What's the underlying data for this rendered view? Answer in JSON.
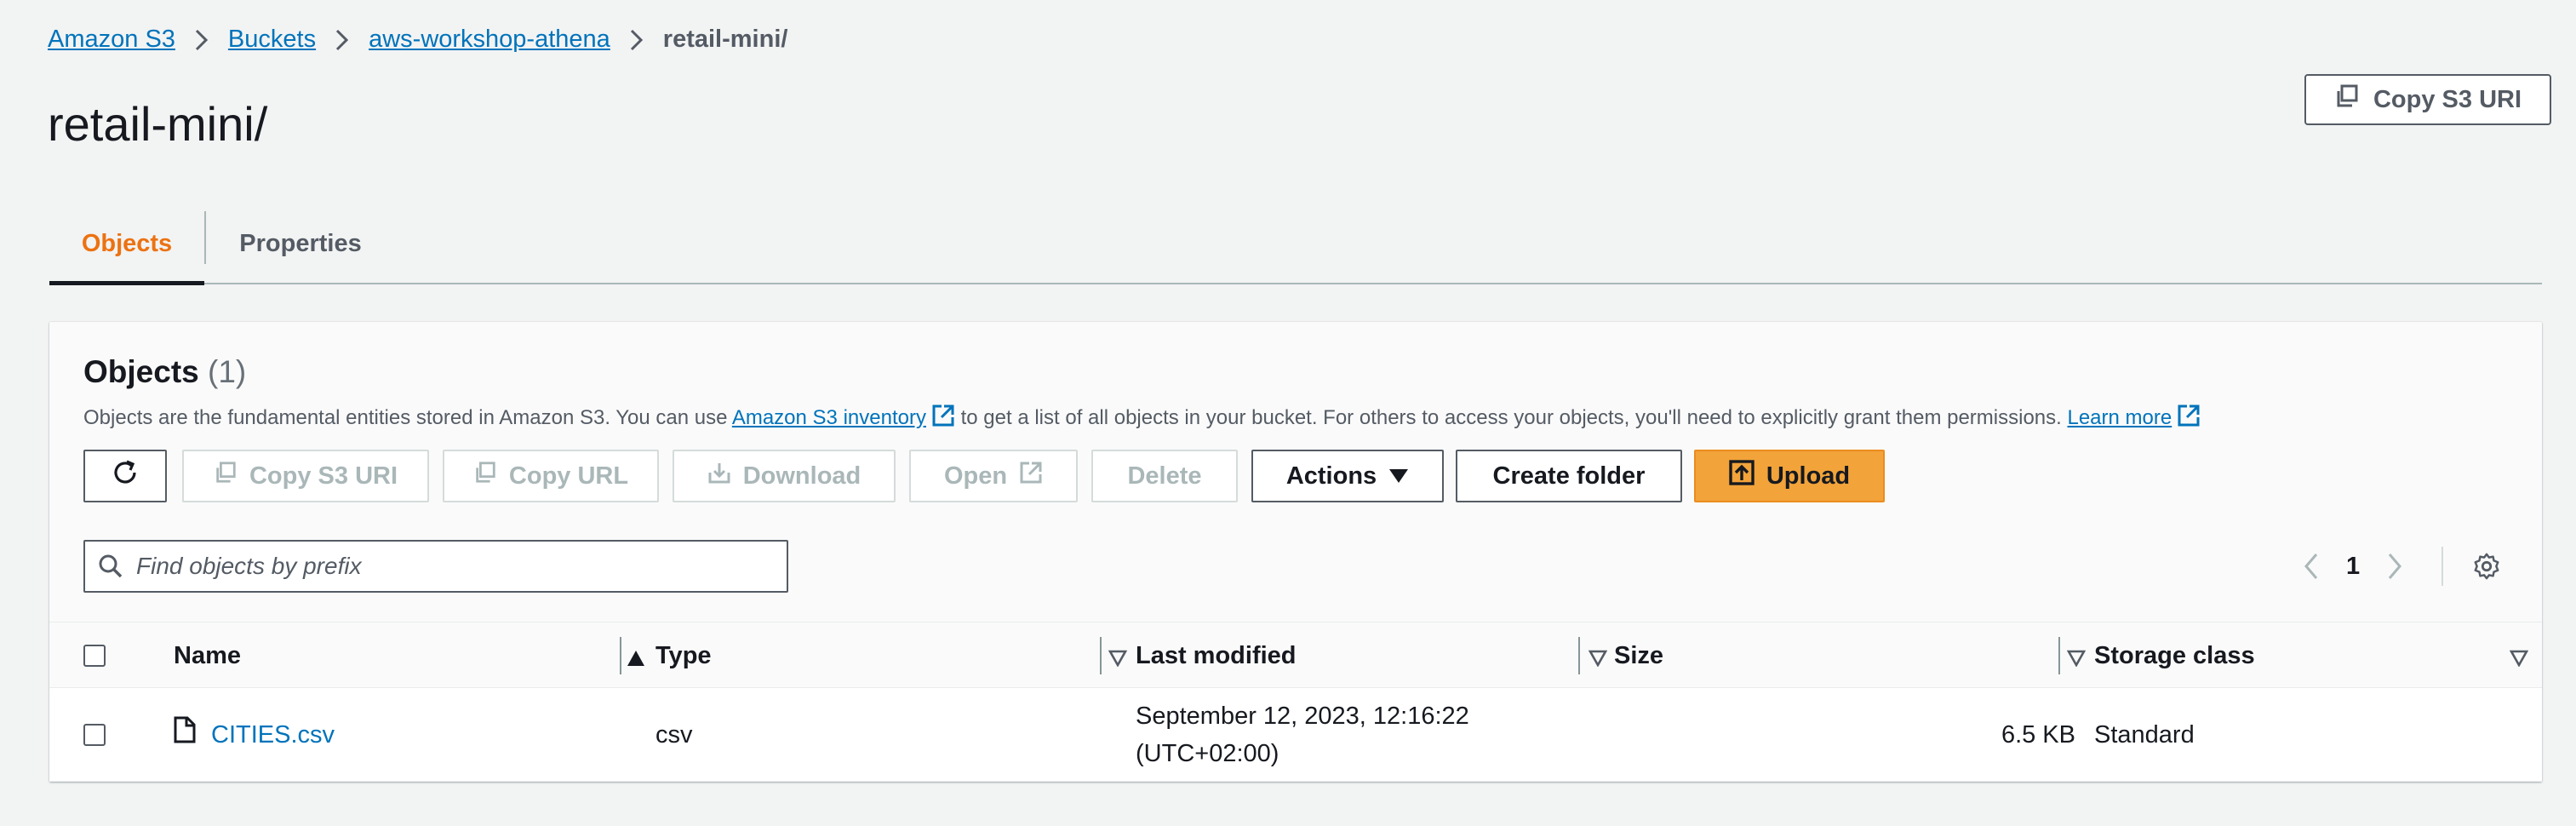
{
  "breadcrumb": {
    "items": [
      "Amazon S3",
      "Buckets",
      "aws-workshop-athena"
    ],
    "current": "retail-mini/"
  },
  "page": {
    "title": "retail-mini/",
    "copy_uri_label": "Copy S3 URI"
  },
  "tabs": [
    {
      "label": "Objects",
      "active": true
    },
    {
      "label": "Properties",
      "active": false
    }
  ],
  "objects_panel": {
    "title": "Objects",
    "count": "(1)",
    "description_1": "Objects are the fundamental entities stored in Amazon S3. You can use ",
    "inventory_link": "Amazon S3 inventory",
    "description_2": " to get a list of all objects in your bucket. For others to access your objects, you'll need to explicitly grant them permissions. ",
    "learn_more": "Learn more"
  },
  "toolbar": {
    "copy_s3_uri": "Copy S3 URI",
    "copy_url": "Copy URL",
    "download": "Download",
    "open": "Open",
    "delete": "Delete",
    "actions": "Actions",
    "create_folder": "Create folder",
    "upload": "Upload"
  },
  "search": {
    "placeholder": "Find objects by prefix",
    "value": ""
  },
  "pagination": {
    "current_page": "1"
  },
  "table": {
    "columns": [
      "Name",
      "Type",
      "Last modified",
      "Size",
      "Storage class"
    ],
    "rows": [
      {
        "name": "CITIES.csv",
        "type": "csv",
        "last_modified_line1": "September 12, 2023, 12:16:22",
        "last_modified_line2": "(UTC+02:00)",
        "size": "6.5 KB",
        "storage_class": "Standard"
      }
    ]
  },
  "colors": {
    "link": "#0073bb",
    "active_tab": "#ec7211",
    "primary_button": "#f2a33a",
    "disabled": "#aab7b8"
  }
}
